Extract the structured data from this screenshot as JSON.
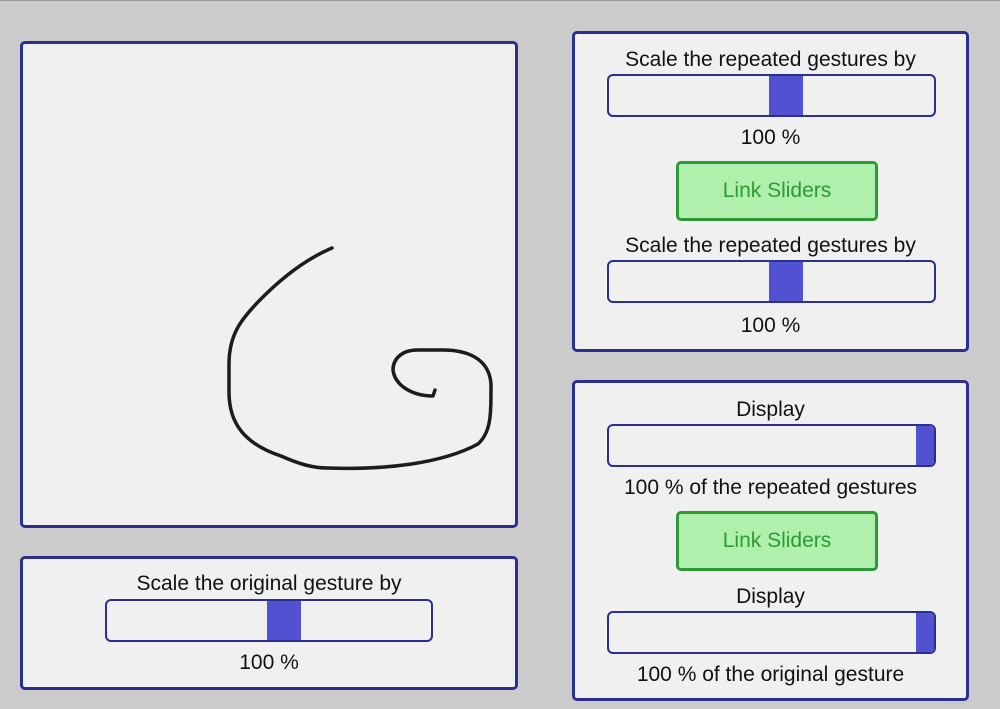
{
  "canvas": {
    "stroke_color": "#1c1c1c"
  },
  "original_panel": {
    "label": "Scale the original gesture by",
    "value_text": "100 %",
    "slider_fraction": 0.55
  },
  "repeated_panel": {
    "slider1_label": "Scale the repeated gestures by",
    "slider1_value_text": "100 %",
    "slider1_fraction": 0.55,
    "link_button_label": "Link Sliders",
    "slider2_label": "Scale the repeated gestures by",
    "slider2_value_text": "100 %",
    "slider2_fraction": 0.55
  },
  "display_panel": {
    "slider1_label": "Display",
    "slider1_value_text": "100 % of the repeated gestures",
    "slider1_fraction": 1.0,
    "link_button_label": "Link Sliders",
    "slider2_label": "Display",
    "slider2_value_text": "100 % of the original gesture",
    "slider2_fraction": 1.0
  },
  "colors": {
    "panel_border": "#2b2f8f",
    "slider_thumb": "#5151d1",
    "button_fill": "#aff0ad",
    "button_border": "#2e9a36",
    "background": "#cbcbcb"
  }
}
